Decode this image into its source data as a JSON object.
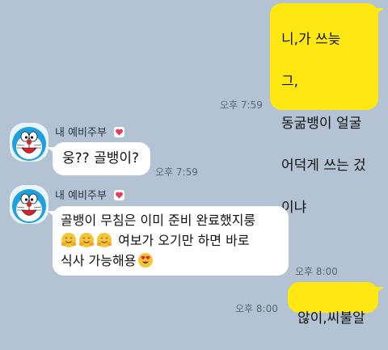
{
  "messages": {
    "m1": {
      "lines": [
        "니,가 쓰늦",
        "그,",
        "동굶뱅이 얼굴",
        "어덕게 쓰는 겄",
        "이냐"
      ],
      "time": "오후 7:59"
    },
    "sender_name": "내 예비주부",
    "m2": {
      "text": "웅?? 골뱅이?",
      "time": "오후 7:59"
    },
    "m3": {
      "line1": "골뱅이 무침은 이미 준비 완료했지룽",
      "line2": "여보가 오기만 하면 바로",
      "line3": "식사 가능해용",
      "time": "오후 8:00"
    },
    "m4": {
      "text": "않이,씨불알",
      "time": "오후 8:00"
    }
  },
  "icons": {
    "avatar": "doraemon-avatar",
    "badge": "heart-badge-icon",
    "emoji_hug": "hugging-face-emoji",
    "emoji_heart_eyes": "heart-eyes-emoji"
  },
  "colors": {
    "background": "#b3c3d3",
    "outgoing_bubble": "#ffe812",
    "incoming_bubble": "#ffffff"
  }
}
